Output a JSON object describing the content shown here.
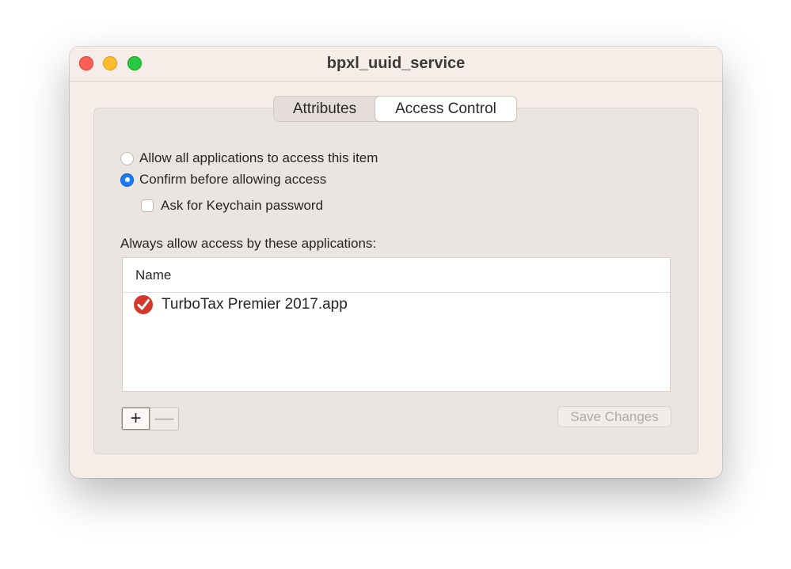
{
  "window": {
    "title": "bpxl_uuid_service"
  },
  "tabs": [
    {
      "label": "Attributes",
      "selected": false
    },
    {
      "label": "Access Control",
      "selected": true
    }
  ],
  "access": {
    "option_allow_all": "Allow all applications to access this item",
    "option_confirm": "Confirm before allowing access",
    "selected_option": "confirm",
    "ask_keychain_label": "Ask for Keychain password",
    "ask_keychain_checked": false,
    "list_label": "Always allow access by these applications:",
    "list_header": "Name",
    "apps": [
      {
        "name": "TurboTax Premier 2017.app",
        "icon": "turbotax-check-icon"
      }
    ]
  },
  "buttons": {
    "add_label": "+",
    "remove_label": "—",
    "save_label": "Save Changes",
    "save_enabled": false
  },
  "colors": {
    "accent": "#1a7cf5",
    "close": "#fe5f57",
    "minimize": "#febc2e",
    "zoom": "#28c840",
    "app_icon": "#d6372b"
  }
}
